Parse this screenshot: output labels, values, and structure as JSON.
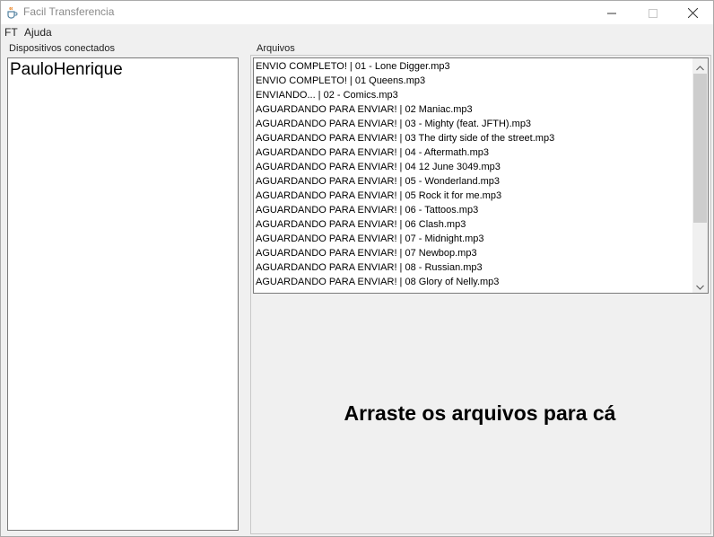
{
  "window": {
    "title": "Facil Transferencia",
    "icon": "java-cup-icon",
    "controls": [
      "minimize-icon",
      "maximize-icon",
      "close-icon"
    ]
  },
  "menu": {
    "items": [
      "FT",
      "Ajuda"
    ]
  },
  "devices": {
    "label": "Dispositivos conectados",
    "items": [
      "PauloHenrique"
    ]
  },
  "files": {
    "label": "Arquivos",
    "rows": [
      "ENVIO COMPLETO! | 01 - Lone Digger.mp3",
      "ENVIO COMPLETO! | 01 Queens.mp3",
      "ENVIANDO... | 02 - Comics.mp3",
      "AGUARDANDO PARA ENVIAR! | 02 Maniac.mp3",
      "AGUARDANDO PARA ENVIAR! | 03 - Mighty (feat. JFTH).mp3",
      "AGUARDANDO PARA ENVIAR! | 03 The dirty side of the street.mp3",
      "AGUARDANDO PARA ENVIAR! | 04 - Aftermath.mp3",
      "AGUARDANDO PARA ENVIAR! | 04 12 June 3049.mp3",
      "AGUARDANDO PARA ENVIAR! | 05 - Wonderland.mp3",
      "AGUARDANDO PARA ENVIAR! | 05 Rock it for me.mp3",
      "AGUARDANDO PARA ENVIAR! | 06 - Tattoos.mp3",
      "AGUARDANDO PARA ENVIAR! | 06 Clash.mp3",
      "AGUARDANDO PARA ENVIAR! | 07 - Midnight.mp3",
      "AGUARDANDO PARA ENVIAR! | 07 Newbop.mp3",
      "AGUARDANDO PARA ENVIAR! | 08 - Russian.mp3",
      "AGUARDANDO PARA ENVIAR! | 08 Glory of Nelly.mp3"
    ]
  },
  "drop_zone": {
    "text": "Arraste os arquivos para cá"
  }
}
